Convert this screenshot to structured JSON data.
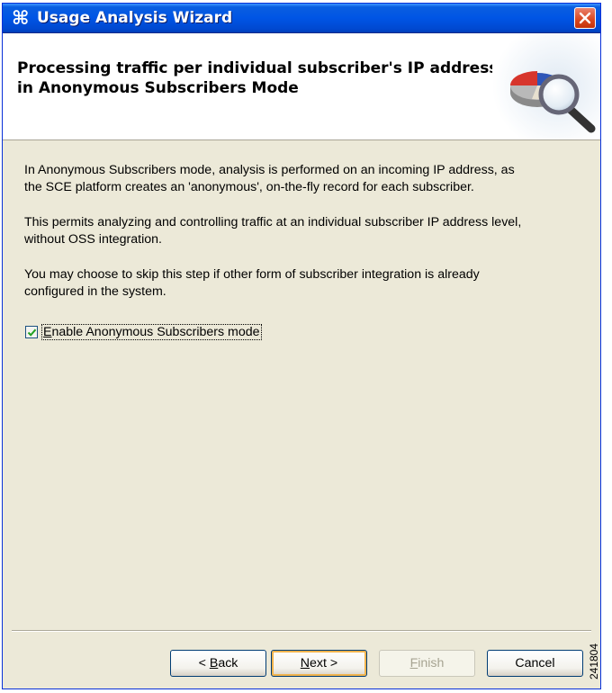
{
  "window": {
    "title": "Usage Analysis Wizard",
    "icon": "cisco-wizard-icon",
    "close_icon": "close-icon"
  },
  "banner": {
    "title_line1": "Processing traffic per individual subscriber's IP address",
    "title_line2": "in Anonymous Subscribers Mode",
    "image": "pie-chart-magnifier-icon"
  },
  "content": {
    "paragraphs": [
      {
        "line1": "In Anonymous Subscribers mode, analysis is performed on an incoming IP address, as",
        "line2": "the SCE platform creates an 'anonymous', on-the-fly record for each subscriber."
      },
      {
        "line1": "This permits analyzing and controlling traffic at an individual subscriber IP address level,",
        "line2": "without OSS integration."
      },
      {
        "line1": "You may choose to skip this step if other form of subscriber integration is already",
        "line2": "configured in the system."
      }
    ],
    "checkbox": {
      "label_mnemonic": "E",
      "label_rest": "nable Anonymous Subscribers mode",
      "checked": true
    }
  },
  "buttons": {
    "back": {
      "prefix": "< ",
      "mnemonic": "B",
      "rest": "ack"
    },
    "next": {
      "mnemonic": "N",
      "rest": "ext >"
    },
    "finish": {
      "mnemonic": "F",
      "rest": "inish",
      "enabled": false
    },
    "cancel": {
      "label": "Cancel"
    }
  },
  "figure_id": "241804",
  "colors": {
    "titlebar": "#0055e5",
    "dialog_background": "#ece9d8",
    "close_button": "#d9461e",
    "default_button_highlight": "#f0b34d"
  }
}
